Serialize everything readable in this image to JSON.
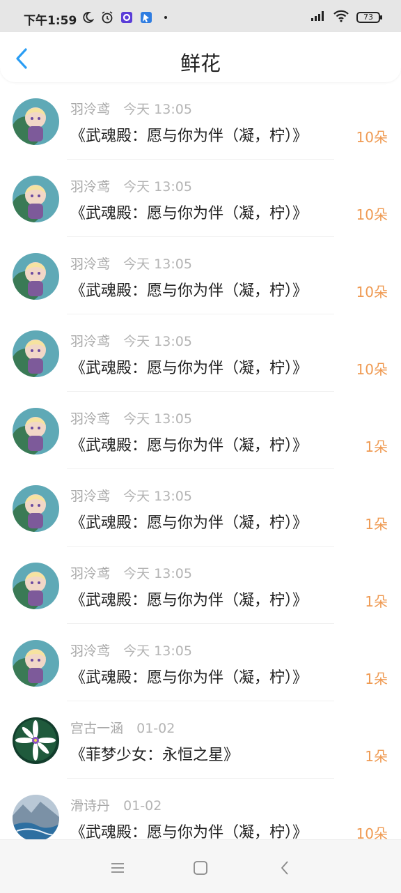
{
  "status_bar": {
    "time": "下午1:59",
    "battery": "73",
    "icons_left": [
      "moon-icon",
      "alarm-icon",
      "app-notification-icon",
      "app-notification-icon-2"
    ],
    "icons_right": [
      "signal-icon",
      "wifi-icon",
      "battery-icon"
    ]
  },
  "header": {
    "title": "鲜花",
    "back_icon": "chevron-left-icon",
    "accent_color": "#2a9df4"
  },
  "list": {
    "accent_color": "#ef9a52",
    "items": [
      {
        "user": "羽泠鸢",
        "time": "今天 13:05",
        "title": "《武魂殿：愿与你为伴（凝，柠）》",
        "flowers": "10朵"
      },
      {
        "user": "羽泠鸢",
        "time": "今天 13:05",
        "title": "《武魂殿：愿与你为伴（凝，柠）》",
        "flowers": "10朵"
      },
      {
        "user": "羽泠鸢",
        "time": "今天 13:05",
        "title": "《武魂殿：愿与你为伴（凝，柠）》",
        "flowers": "10朵"
      },
      {
        "user": "羽泠鸢",
        "time": "今天 13:05",
        "title": "《武魂殿：愿与你为伴（凝，柠）》",
        "flowers": "10朵"
      },
      {
        "user": "羽泠鸢",
        "time": "今天 13:05",
        "title": "《武魂殿：愿与你为伴（凝，柠）》",
        "flowers": "1朵"
      },
      {
        "user": "羽泠鸢",
        "time": "今天 13:05",
        "title": "《武魂殿：愿与你为伴（凝，柠）》",
        "flowers": "1朵"
      },
      {
        "user": "羽泠鸢",
        "time": "今天 13:05",
        "title": "《武魂殿：愿与你为伴（凝，柠）》",
        "flowers": "1朵"
      },
      {
        "user": "羽泠鸢",
        "time": "今天 13:05",
        "title": "《武魂殿：愿与你为伴（凝，柠）》",
        "flowers": "1朵"
      },
      {
        "user": "宫古一涵",
        "time": "01-02",
        "title": "《菲梦少女：永恒之星》",
        "flowers": "1朵"
      },
      {
        "user": "滑诗丹",
        "time": "01-02",
        "title": "《武魂殿：愿与你为伴（凝，柠）》",
        "flowers": "10朵"
      }
    ]
  },
  "nav_bar": {
    "icons": [
      "menu-icon",
      "home-square-icon",
      "back-triangle-icon"
    ]
  }
}
